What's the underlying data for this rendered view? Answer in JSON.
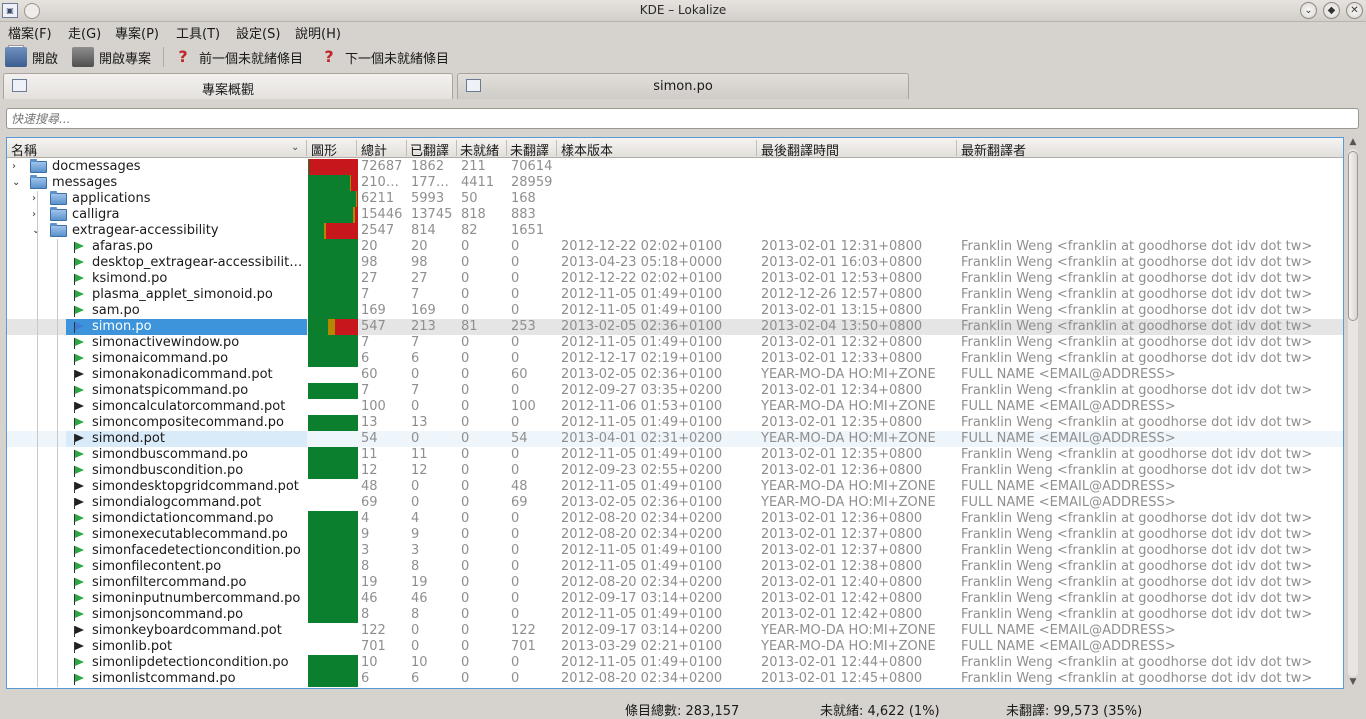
{
  "window": {
    "title": "KDE – Lokalize"
  },
  "menu": [
    "檔案(F)",
    "走(G)",
    "專案(P)",
    "工具(T)",
    "設定(S)",
    "說明(H)"
  ],
  "toolbar": {
    "open": "開啟",
    "open_project": "開啟專案",
    "prev_unready": "前一個未就緒條目",
    "next_unready": "下一個未就緒條目"
  },
  "tabs": [
    {
      "label": "專案概觀",
      "active": true
    },
    {
      "label": "simon.po",
      "active": false
    }
  ],
  "search": {
    "placeholder": "快速搜尋..."
  },
  "columns": {
    "name": "名稱",
    "graph": "圖形",
    "total": "總計",
    "translated": "已翻譯",
    "fuzzy": "未就緒",
    "untranslated": "未翻譯",
    "template_rev": "樣本版本",
    "last_translation": "最後翻譯時間",
    "last_translator": "最新翻譯者"
  },
  "colors": {
    "translated": "#0b7f2d",
    "fuzzy": "#b38800",
    "untranslated": "#c8161d",
    "selection": "#3d94da"
  },
  "rows": [
    {
      "name": "docmessages",
      "type": "folder",
      "depth": 0,
      "expanded": false,
      "total": "72687",
      "translated": "1862",
      "fuzzy": "211",
      "untranslated": "70614",
      "template": "",
      "last": "",
      "translator": "",
      "pct": [
        2.6,
        0.3,
        97.1
      ]
    },
    {
      "name": "messages",
      "type": "folder",
      "depth": 0,
      "expanded": true,
      "total": "210…",
      "translated": "177…",
      "fuzzy": "4411",
      "untranslated": "28959",
      "template": "",
      "last": "",
      "translator": "",
      "pct": [
        84,
        2,
        14
      ]
    },
    {
      "name": "applications",
      "type": "folder",
      "depth": 1,
      "expanded": false,
      "total": "6211",
      "translated": "5993",
      "fuzzy": "50",
      "untranslated": "168",
      "template": "",
      "last": "",
      "translator": "",
      "pct": [
        96.5,
        0.8,
        2.7
      ]
    },
    {
      "name": "calligra",
      "type": "folder",
      "depth": 1,
      "expanded": false,
      "total": "15446",
      "translated": "13745",
      "fuzzy": "818",
      "untranslated": "883",
      "template": "",
      "last": "",
      "translator": "",
      "pct": [
        89,
        5.3,
        5.7
      ]
    },
    {
      "name": "extragear-accessibility",
      "type": "folder",
      "depth": 1,
      "expanded": true,
      "total": "2547",
      "translated": "814",
      "fuzzy": "82",
      "untranslated": "1651",
      "template": "",
      "last": "",
      "translator": "",
      "pct": [
        32,
        3.2,
        64.8
      ]
    },
    {
      "name": "afaras.po",
      "type": "po",
      "depth": 2,
      "total": "20",
      "translated": "20",
      "fuzzy": "0",
      "untranslated": "0",
      "template": "2012-12-22 02:02+0100",
      "last": "2013-02-01 12:31+0800",
      "translator": "Franklin Weng <franklin at goodhorse dot idv dot tw>",
      "pct": [
        100,
        0,
        0
      ]
    },
    {
      "name": "desktop_extragear-accessibilit…",
      "type": "po",
      "depth": 2,
      "total": "98",
      "translated": "98",
      "fuzzy": "0",
      "untranslated": "0",
      "template": "2013-04-23 05:18+0000",
      "last": "2013-02-01 16:03+0800",
      "translator": "Franklin Weng <franklin at goodhorse dot idv dot tw>",
      "pct": [
        100,
        0,
        0
      ]
    },
    {
      "name": "ksimond.po",
      "type": "po",
      "depth": 2,
      "total": "27",
      "translated": "27",
      "fuzzy": "0",
      "untranslated": "0",
      "template": "2012-12-22 02:02+0100",
      "last": "2013-02-01 12:53+0800",
      "translator": "Franklin Weng <franklin at goodhorse dot idv dot tw>",
      "pct": [
        100,
        0,
        0
      ]
    },
    {
      "name": "plasma_applet_simonoid.po",
      "type": "po",
      "depth": 2,
      "total": "7",
      "translated": "7",
      "fuzzy": "0",
      "untranslated": "0",
      "template": "2012-11-05 01:49+0100",
      "last": "2012-12-26 12:57+0800",
      "translator": "Franklin Weng <franklin at goodhorse dot idv dot tw>",
      "pct": [
        100,
        0,
        0
      ]
    },
    {
      "name": "sam.po",
      "type": "po",
      "depth": 2,
      "total": "169",
      "translated": "169",
      "fuzzy": "0",
      "untranslated": "0",
      "template": "2012-11-05 01:49+0100",
      "last": "2013-02-01 13:15+0800",
      "translator": "Franklin Weng <franklin at goodhorse dot idv dot tw>",
      "pct": [
        100,
        0,
        0
      ]
    },
    {
      "name": "simon.po",
      "type": "po-sel",
      "depth": 2,
      "selected": true,
      "total": "547",
      "translated": "213",
      "fuzzy": "81",
      "untranslated": "253",
      "template": "2013-02-05 02:36+0100",
      "last": "2013-02-04 13:50+0800",
      "translator": "Franklin Weng <franklin at goodhorse dot idv dot tw>",
      "pct": [
        39,
        14.8,
        46.2
      ]
    },
    {
      "name": "simonactivewindow.po",
      "type": "po",
      "depth": 2,
      "total": "7",
      "translated": "7",
      "fuzzy": "0",
      "untranslated": "0",
      "template": "2012-11-05 01:49+0100",
      "last": "2013-02-01 12:32+0800",
      "translator": "Franklin Weng <franklin at goodhorse dot idv dot tw>",
      "pct": [
        100,
        0,
        0
      ]
    },
    {
      "name": "simonaicommand.po",
      "type": "po",
      "depth": 2,
      "total": "6",
      "translated": "6",
      "fuzzy": "0",
      "untranslated": "0",
      "template": "2012-12-17 02:19+0100",
      "last": "2013-02-01 12:33+0800",
      "translator": "Franklin Weng <franklin at goodhorse dot idv dot tw>",
      "pct": [
        100,
        0,
        0
      ]
    },
    {
      "name": "simonakonadicommand.pot",
      "type": "pot",
      "depth": 2,
      "total": "60",
      "translated": "0",
      "fuzzy": "0",
      "untranslated": "60",
      "template": "2013-02-05 02:36+0100",
      "last": "YEAR-MO-DA HO:MI+ZONE",
      "translator": "FULL NAME <EMAIL@ADDRESS>",
      "pct": [
        0,
        0,
        0
      ]
    },
    {
      "name": "simonatspicommand.po",
      "type": "po",
      "depth": 2,
      "total": "7",
      "translated": "7",
      "fuzzy": "0",
      "untranslated": "0",
      "template": "2012-09-27 03:35+0200",
      "last": "2013-02-01 12:34+0800",
      "translator": "Franklin Weng <franklin at goodhorse dot idv dot tw>",
      "pct": [
        100,
        0,
        0
      ]
    },
    {
      "name": "simoncalculatorcommand.pot",
      "type": "pot",
      "depth": 2,
      "total": "100",
      "translated": "0",
      "fuzzy": "0",
      "untranslated": "100",
      "template": "2012-11-06 01:53+0100",
      "last": "YEAR-MO-DA HO:MI+ZONE",
      "translator": "FULL NAME <EMAIL@ADDRESS>",
      "pct": [
        0,
        0,
        0
      ]
    },
    {
      "name": "simoncompositecommand.po",
      "type": "po",
      "depth": 2,
      "total": "13",
      "translated": "13",
      "fuzzy": "0",
      "untranslated": "0",
      "template": "2012-11-05 01:49+0100",
      "last": "2013-02-01 12:35+0800",
      "translator": "Franklin Weng <franklin at goodhorse dot idv dot tw>",
      "pct": [
        100,
        0,
        0
      ]
    },
    {
      "name": "simond.pot",
      "type": "pot-hover",
      "depth": 2,
      "hover": true,
      "total": "54",
      "translated": "0",
      "fuzzy": "0",
      "untranslated": "54",
      "template": "2013-04-01 02:31+0200",
      "last": "YEAR-MO-DA HO:MI+ZONE",
      "translator": "FULL NAME <EMAIL@ADDRESS>",
      "pct": [
        0,
        0,
        0
      ]
    },
    {
      "name": "simondbuscommand.po",
      "type": "po",
      "depth": 2,
      "total": "11",
      "translated": "11",
      "fuzzy": "0",
      "untranslated": "0",
      "template": "2012-11-05 01:49+0100",
      "last": "2013-02-01 12:35+0800",
      "translator": "Franklin Weng <franklin at goodhorse dot idv dot tw>",
      "pct": [
        100,
        0,
        0
      ]
    },
    {
      "name": "simondbuscondition.po",
      "type": "po",
      "depth": 2,
      "total": "12",
      "translated": "12",
      "fuzzy": "0",
      "untranslated": "0",
      "template": "2012-09-23 02:55+0200",
      "last": "2013-02-01 12:36+0800",
      "translator": "Franklin Weng <franklin at goodhorse dot idv dot tw>",
      "pct": [
        100,
        0,
        0
      ]
    },
    {
      "name": "simondesktopgridcommand.pot",
      "type": "pot",
      "depth": 2,
      "total": "48",
      "translated": "0",
      "fuzzy": "0",
      "untranslated": "48",
      "template": "2012-11-05 01:49+0100",
      "last": "YEAR-MO-DA HO:MI+ZONE",
      "translator": "FULL NAME <EMAIL@ADDRESS>",
      "pct": [
        0,
        0,
        0
      ]
    },
    {
      "name": "simondialogcommand.pot",
      "type": "pot",
      "depth": 2,
      "total": "69",
      "translated": "0",
      "fuzzy": "0",
      "untranslated": "69",
      "template": "2013-02-05 02:36+0100",
      "last": "YEAR-MO-DA HO:MI+ZONE",
      "translator": "FULL NAME <EMAIL@ADDRESS>",
      "pct": [
        0,
        0,
        0
      ]
    },
    {
      "name": "simondictationcommand.po",
      "type": "po",
      "depth": 2,
      "total": "4",
      "translated": "4",
      "fuzzy": "0",
      "untranslated": "0",
      "template": "2012-08-20 02:34+0200",
      "last": "2013-02-01 12:36+0800",
      "translator": "Franklin Weng <franklin at goodhorse dot idv dot tw>",
      "pct": [
        100,
        0,
        0
      ]
    },
    {
      "name": "simonexecutablecommand.po",
      "type": "po",
      "depth": 2,
      "total": "9",
      "translated": "9",
      "fuzzy": "0",
      "untranslated": "0",
      "template": "2012-08-20 02:34+0200",
      "last": "2013-02-01 12:37+0800",
      "translator": "Franklin Weng <franklin at goodhorse dot idv dot tw>",
      "pct": [
        100,
        0,
        0
      ]
    },
    {
      "name": "simonfacedetectioncondition.po",
      "type": "po",
      "depth": 2,
      "total": "3",
      "translated": "3",
      "fuzzy": "0",
      "untranslated": "0",
      "template": "2012-11-05 01:49+0100",
      "last": "2013-02-01 12:37+0800",
      "translator": "Franklin Weng <franklin at goodhorse dot idv dot tw>",
      "pct": [
        100,
        0,
        0
      ]
    },
    {
      "name": "simonfilecontent.po",
      "type": "po",
      "depth": 2,
      "total": "8",
      "translated": "8",
      "fuzzy": "0",
      "untranslated": "0",
      "template": "2012-11-05 01:49+0100",
      "last": "2013-02-01 12:38+0800",
      "translator": "Franklin Weng <franklin at goodhorse dot idv dot tw>",
      "pct": [
        100,
        0,
        0
      ]
    },
    {
      "name": "simonfiltercommand.po",
      "type": "po",
      "depth": 2,
      "total": "19",
      "translated": "19",
      "fuzzy": "0",
      "untranslated": "0",
      "template": "2012-08-20 02:34+0200",
      "last": "2013-02-01 12:40+0800",
      "translator": "Franklin Weng <franklin at goodhorse dot idv dot tw>",
      "pct": [
        100,
        0,
        0
      ]
    },
    {
      "name": "simoninputnumbercommand.po",
      "type": "po",
      "depth": 2,
      "total": "46",
      "translated": "46",
      "fuzzy": "0",
      "untranslated": "0",
      "template": "2012-09-17 03:14+0200",
      "last": "2013-02-01 12:42+0800",
      "translator": "Franklin Weng <franklin at goodhorse dot idv dot tw>",
      "pct": [
        100,
        0,
        0
      ]
    },
    {
      "name": "simonjsoncommand.po",
      "type": "po",
      "depth": 2,
      "total": "8",
      "translated": "8",
      "fuzzy": "0",
      "untranslated": "0",
      "template": "2012-11-05 01:49+0100",
      "last": "2013-02-01 12:42+0800",
      "translator": "Franklin Weng <franklin at goodhorse dot idv dot tw>",
      "pct": [
        100,
        0,
        0
      ]
    },
    {
      "name": "simonkeyboardcommand.pot",
      "type": "pot",
      "depth": 2,
      "total": "122",
      "translated": "0",
      "fuzzy": "0",
      "untranslated": "122",
      "template": "2012-09-17 03:14+0200",
      "last": "YEAR-MO-DA HO:MI+ZONE",
      "translator": "FULL NAME <EMAIL@ADDRESS>",
      "pct": [
        0,
        0,
        0
      ]
    },
    {
      "name": "simonlib.pot",
      "type": "pot",
      "depth": 2,
      "total": "701",
      "translated": "0",
      "fuzzy": "0",
      "untranslated": "701",
      "template": "2013-03-29 02:21+0100",
      "last": "YEAR-MO-DA HO:MI+ZONE",
      "translator": "FULL NAME <EMAIL@ADDRESS>",
      "pct": [
        0,
        0,
        0
      ]
    },
    {
      "name": "simonlipdetectioncondition.po",
      "type": "po",
      "depth": 2,
      "total": "10",
      "translated": "10",
      "fuzzy": "0",
      "untranslated": "0",
      "template": "2012-11-05 01:49+0100",
      "last": "2013-02-01 12:44+0800",
      "translator": "Franklin Weng <franklin at goodhorse dot idv dot tw>",
      "pct": [
        100,
        0,
        0
      ]
    },
    {
      "name": "simonlistcommand.po",
      "type": "po",
      "depth": 2,
      "total": "6",
      "translated": "6",
      "fuzzy": "0",
      "untranslated": "0",
      "template": "2012-08-20 02:34+0200",
      "last": "2013-02-01 12:45+0800",
      "translator": "Franklin Weng <franklin at goodhorse dot idv dot tw>",
      "pct": [
        100,
        0,
        0
      ]
    }
  ],
  "status": {
    "total": "條目總數: 283,157",
    "fuzzy": "未就緒: 4,622 (1%)",
    "untranslated": "未翻譯: 99,573 (35%)"
  }
}
